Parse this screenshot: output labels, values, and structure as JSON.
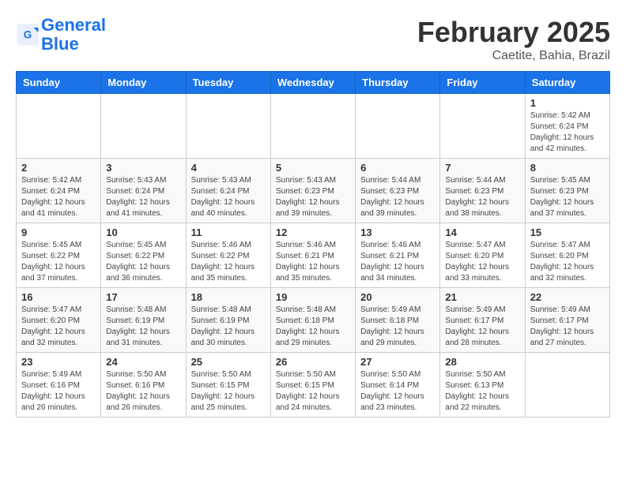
{
  "header": {
    "logo_line1": "General",
    "logo_line2": "Blue",
    "month_title": "February 2025",
    "location": "Caetite, Bahia, Brazil"
  },
  "weekdays": [
    "Sunday",
    "Monday",
    "Tuesday",
    "Wednesday",
    "Thursday",
    "Friday",
    "Saturday"
  ],
  "weeks": [
    [
      {
        "day": "",
        "info": ""
      },
      {
        "day": "",
        "info": ""
      },
      {
        "day": "",
        "info": ""
      },
      {
        "day": "",
        "info": ""
      },
      {
        "day": "",
        "info": ""
      },
      {
        "day": "",
        "info": ""
      },
      {
        "day": "1",
        "info": "Sunrise: 5:42 AM\nSunset: 6:24 PM\nDaylight: 12 hours\nand 42 minutes."
      }
    ],
    [
      {
        "day": "2",
        "info": "Sunrise: 5:42 AM\nSunset: 6:24 PM\nDaylight: 12 hours\nand 41 minutes."
      },
      {
        "day": "3",
        "info": "Sunrise: 5:43 AM\nSunset: 6:24 PM\nDaylight: 12 hours\nand 41 minutes."
      },
      {
        "day": "4",
        "info": "Sunrise: 5:43 AM\nSunset: 6:24 PM\nDaylight: 12 hours\nand 40 minutes."
      },
      {
        "day": "5",
        "info": "Sunrise: 5:43 AM\nSunset: 6:23 PM\nDaylight: 12 hours\nand 39 minutes."
      },
      {
        "day": "6",
        "info": "Sunrise: 5:44 AM\nSunset: 6:23 PM\nDaylight: 12 hours\nand 39 minutes."
      },
      {
        "day": "7",
        "info": "Sunrise: 5:44 AM\nSunset: 6:23 PM\nDaylight: 12 hours\nand 38 minutes."
      },
      {
        "day": "8",
        "info": "Sunrise: 5:45 AM\nSunset: 6:23 PM\nDaylight: 12 hours\nand 37 minutes."
      }
    ],
    [
      {
        "day": "9",
        "info": "Sunrise: 5:45 AM\nSunset: 6:22 PM\nDaylight: 12 hours\nand 37 minutes."
      },
      {
        "day": "10",
        "info": "Sunrise: 5:45 AM\nSunset: 6:22 PM\nDaylight: 12 hours\nand 36 minutes."
      },
      {
        "day": "11",
        "info": "Sunrise: 5:46 AM\nSunset: 6:22 PM\nDaylight: 12 hours\nand 35 minutes."
      },
      {
        "day": "12",
        "info": "Sunrise: 5:46 AM\nSunset: 6:21 PM\nDaylight: 12 hours\nand 35 minutes."
      },
      {
        "day": "13",
        "info": "Sunrise: 5:46 AM\nSunset: 6:21 PM\nDaylight: 12 hours\nand 34 minutes."
      },
      {
        "day": "14",
        "info": "Sunrise: 5:47 AM\nSunset: 6:20 PM\nDaylight: 12 hours\nand 33 minutes."
      },
      {
        "day": "15",
        "info": "Sunrise: 5:47 AM\nSunset: 6:20 PM\nDaylight: 12 hours\nand 32 minutes."
      }
    ],
    [
      {
        "day": "16",
        "info": "Sunrise: 5:47 AM\nSunset: 6:20 PM\nDaylight: 12 hours\nand 32 minutes."
      },
      {
        "day": "17",
        "info": "Sunrise: 5:48 AM\nSunset: 6:19 PM\nDaylight: 12 hours\nand 31 minutes."
      },
      {
        "day": "18",
        "info": "Sunrise: 5:48 AM\nSunset: 6:19 PM\nDaylight: 12 hours\nand 30 minutes."
      },
      {
        "day": "19",
        "info": "Sunrise: 5:48 AM\nSunset: 6:18 PM\nDaylight: 12 hours\nand 29 minutes."
      },
      {
        "day": "20",
        "info": "Sunrise: 5:49 AM\nSunset: 6:18 PM\nDaylight: 12 hours\nand 29 minutes."
      },
      {
        "day": "21",
        "info": "Sunrise: 5:49 AM\nSunset: 6:17 PM\nDaylight: 12 hours\nand 28 minutes."
      },
      {
        "day": "22",
        "info": "Sunrise: 5:49 AM\nSunset: 6:17 PM\nDaylight: 12 hours\nand 27 minutes."
      }
    ],
    [
      {
        "day": "23",
        "info": "Sunrise: 5:49 AM\nSunset: 6:16 PM\nDaylight: 12 hours\nand 26 minutes."
      },
      {
        "day": "24",
        "info": "Sunrise: 5:50 AM\nSunset: 6:16 PM\nDaylight: 12 hours\nand 26 minutes."
      },
      {
        "day": "25",
        "info": "Sunrise: 5:50 AM\nSunset: 6:15 PM\nDaylight: 12 hours\nand 25 minutes."
      },
      {
        "day": "26",
        "info": "Sunrise: 5:50 AM\nSunset: 6:15 PM\nDaylight: 12 hours\nand 24 minutes."
      },
      {
        "day": "27",
        "info": "Sunrise: 5:50 AM\nSunset: 6:14 PM\nDaylight: 12 hours\nand 23 minutes."
      },
      {
        "day": "28",
        "info": "Sunrise: 5:50 AM\nSunset: 6:13 PM\nDaylight: 12 hours\nand 22 minutes."
      },
      {
        "day": "",
        "info": ""
      }
    ]
  ]
}
